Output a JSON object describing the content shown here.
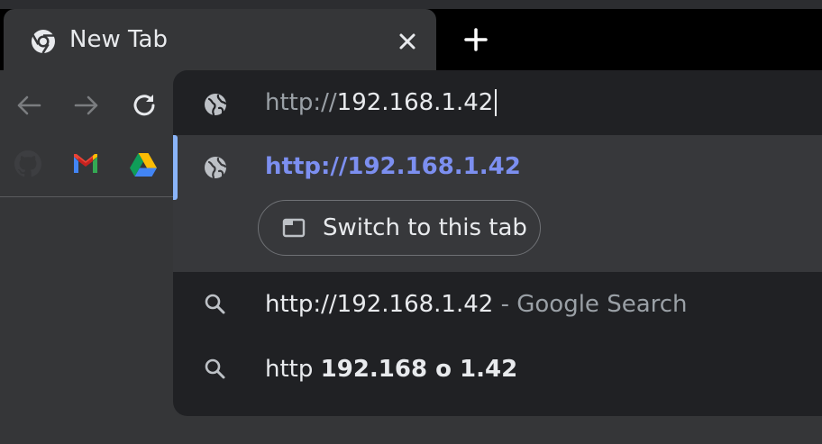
{
  "tab": {
    "title": "New Tab",
    "icon": "chrome-icon",
    "close_icon": "close-icon"
  },
  "new_tab_icon": "plus-icon",
  "toolbar": {
    "back_icon": "arrow-left-icon",
    "forward_icon": "arrow-right-icon",
    "reload_icon": "reload-icon"
  },
  "bookmarks": [
    {
      "icon": "github-icon"
    },
    {
      "icon": "gmail-icon"
    },
    {
      "icon": "google-drive-icon"
    }
  ],
  "omnibox": {
    "input_scheme": "http://",
    "input_host": "192.168.1.42",
    "input_icon": "globe-icon",
    "selected_suggestion": {
      "icon": "globe-icon",
      "url": "http://192.168.1.42",
      "action_label": "Switch to this tab",
      "action_icon": "tab-icon"
    },
    "suggestions": [
      {
        "icon": "search-icon",
        "main": "http://192.168.1.42",
        "suffix": " - Google Search"
      },
      {
        "icon": "search-icon",
        "part1": "http ",
        "part2": "192.168 o 1.42"
      }
    ]
  },
  "colors": {
    "background": "#353638",
    "omnibox_bg": "#202124",
    "selected_bg": "#37383b",
    "selected_url": "#7c8ff0",
    "accent_bar": "#8ab4f8"
  }
}
